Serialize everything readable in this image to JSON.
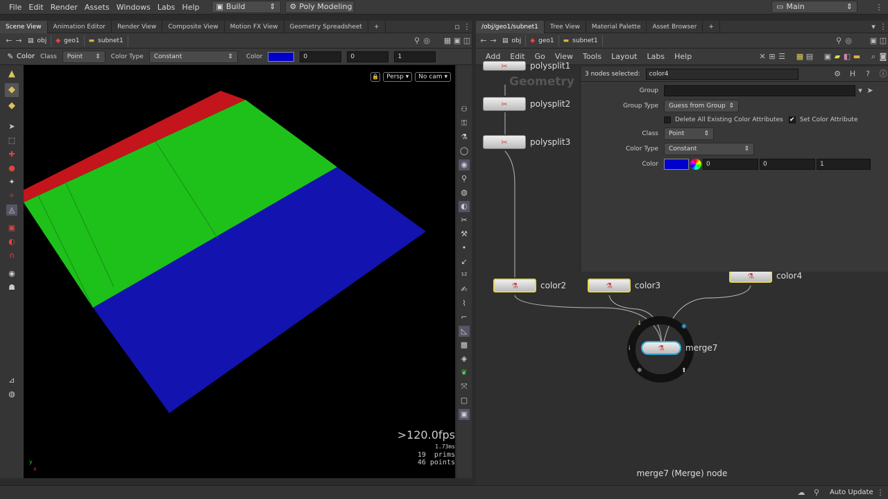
{
  "menubar": {
    "items": [
      "File",
      "Edit",
      "Render",
      "Assets",
      "Windows",
      "Labs",
      "Help"
    ],
    "desktop": "Build",
    "shelf": "Poly Modeling",
    "session": "Main"
  },
  "left": {
    "tabs": [
      "Scene View",
      "Animation Editor",
      "Render View",
      "Composite View",
      "Motion FX View",
      "Geometry Spreadsheet"
    ],
    "path": [
      "obj",
      "geo1",
      "subnet1"
    ],
    "op": {
      "tool": "Color",
      "class_label": "Class",
      "class_value": "Point",
      "colortype_label": "Color Type",
      "colortype_value": "Constant",
      "color_label": "Color",
      "r": "0",
      "g": "0",
      "b": "1",
      "swatch": "#0000cc"
    },
    "persp": "Persp",
    "cam": "No cam",
    "stats": {
      "fps": ">120.0fps",
      "ms": "1.73ms",
      "prims": "19  prims",
      "points": "46 points"
    },
    "axis_y": "y",
    "axis_x": "x"
  },
  "right": {
    "tabs": [
      "/obj/geo1/subnet1",
      "Tree View",
      "Material Palette",
      "Asset Browser"
    ],
    "path": [
      "obj",
      "geo1",
      "subnet1"
    ],
    "menu": [
      "Add",
      "Edit",
      "Go",
      "View",
      "Tools",
      "Layout",
      "Labs",
      "Help"
    ],
    "selected_count": "3 nodes selected:",
    "node_name": "color4",
    "network_label": "Geometry",
    "parms": {
      "group_label": "Group",
      "group_value": "",
      "grouptype_label": "Group Type",
      "grouptype_value": "Guess from Group",
      "delete_label": "Delete All Existing Color Attributes",
      "setcolor_label": "Set Color Attribute",
      "class_label": "Class",
      "class_value": "Point",
      "colortype_label": "Color Type",
      "colortype_value": "Constant",
      "color_label": "Color",
      "r": "0",
      "g": "0",
      "b": "1",
      "swatch": "#0000cc"
    },
    "nodes": {
      "ps1": "polysplit1",
      "ps2": "polysplit2",
      "ps3": "polysplit3",
      "c2": "color2",
      "c3": "color3",
      "c4": "color4",
      "merge": "merge7"
    },
    "footer": "merge7 (Merge) node"
  },
  "status": {
    "update": "Auto Update"
  }
}
